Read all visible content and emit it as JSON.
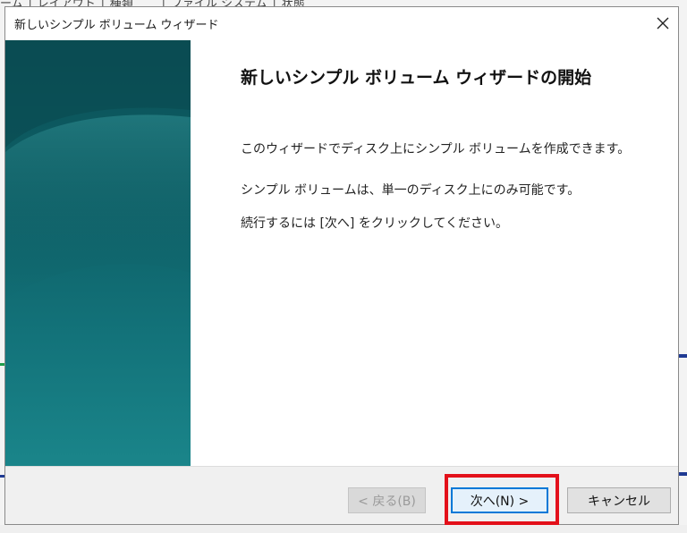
{
  "background": {
    "header_text": "ーム │ レイアウト │ 種類 　　│ ファイル システム │ 状態"
  },
  "dialog": {
    "title": "新しいシンプル ボリューム ウィザード",
    "heading": "新しいシンプル ボリューム ウィザードの開始",
    "paragraphs": [
      "このウィザードでディスク上にシンプル ボリュームを作成できます。",
      "シンプル ボリュームは、単一のディスク上にのみ可能です。",
      "続行するには [次へ] をクリックしてください。"
    ],
    "buttons": {
      "back": "< 戻る(B)",
      "next": "次へ(N) >",
      "cancel": "キャンセル"
    }
  },
  "colors": {
    "side_panel": "#0e6168",
    "highlight": "#e3101a",
    "default_button_border": "#0078d7"
  },
  "icons": {
    "close": "close-icon"
  }
}
